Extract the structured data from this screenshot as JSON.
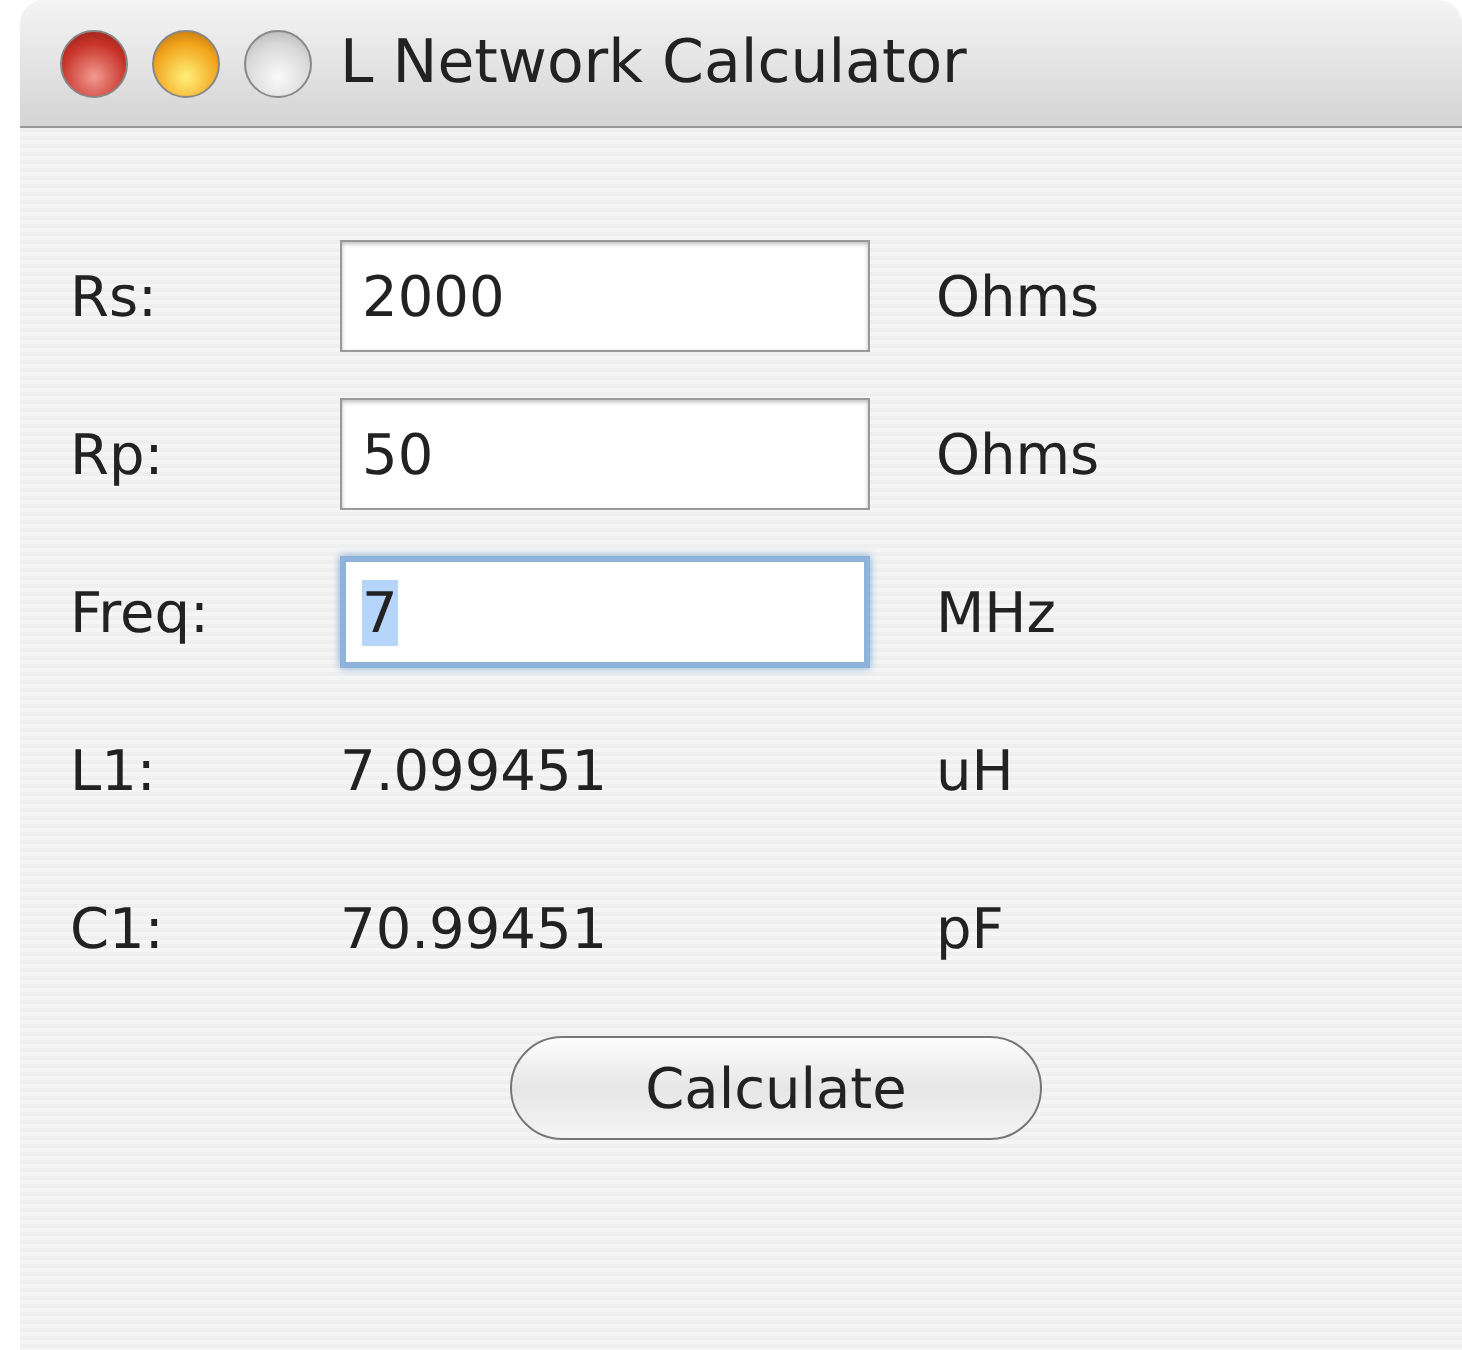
{
  "window": {
    "title": "L Network Calculator"
  },
  "rows": [
    {
      "label": "Rs:",
      "kind": "input",
      "value": "2000",
      "unit": "Ohms",
      "focused": false
    },
    {
      "label": "Rp:",
      "kind": "input",
      "value": "50",
      "unit": "Ohms",
      "focused": false
    },
    {
      "label": "Freq:",
      "kind": "input",
      "value": "7",
      "unit": "MHz",
      "focused": true
    },
    {
      "label": "L1:",
      "kind": "output",
      "value": "7.099451",
      "unit": "uH"
    },
    {
      "label": "C1:",
      "kind": "output",
      "value": "70.99451",
      "unit": "pF"
    }
  ],
  "button": "Calculate"
}
